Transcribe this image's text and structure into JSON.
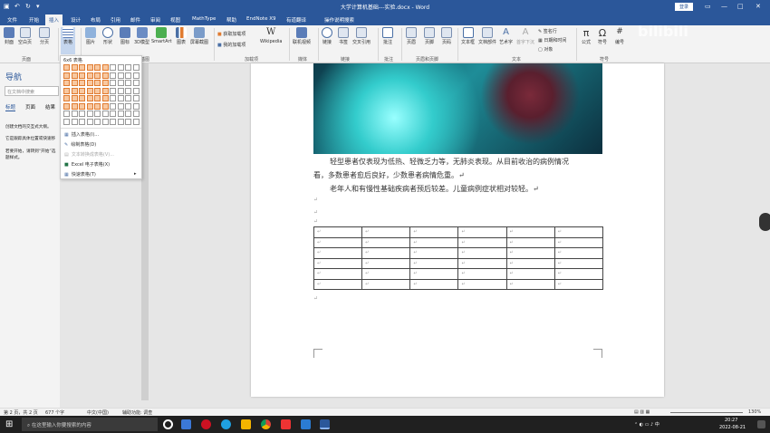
{
  "title": "大学计算机基础---实验.docx  -  Word",
  "user": "登录",
  "tabs": [
    "文件",
    "开始",
    "插入",
    "设计",
    "布局",
    "引用",
    "邮件",
    "审阅",
    "视图",
    "MathType",
    "帮助",
    "EndNote X9",
    "有道翻译",
    "操作说明搜索"
  ],
  "active_tab": "插入",
  "ribbon": {
    "buttons": [
      "封面",
      "空白页",
      "分页",
      "表格",
      "图片",
      "形状",
      "图标",
      "3D模型",
      "SmartArt",
      "图表",
      "屏幕截图",
      "获取加载项",
      "我的加载项",
      "Wikipedia",
      "联机视频",
      "链接",
      "书签",
      "交叉引用",
      "批注",
      "页眉",
      "页脚",
      "页码",
      "文本框",
      "文档部件",
      "艺术字",
      "首字下沉",
      "签名行",
      "日期和时间",
      "对象",
      "公式",
      "符号",
      "编号"
    ],
    "groups": [
      "页面",
      "插图",
      "加载项",
      "媒体",
      "链接",
      "批注",
      "页眉和页脚",
      "文本",
      "符号"
    ]
  },
  "table_popup": {
    "header": "6x6 表格",
    "menu": [
      "插入表格(I)...",
      "绘制表格(D)",
      "文本转换成表格(V)...",
      "Excel 电子表格(X)",
      "快速表格(T)"
    ]
  },
  "nav": {
    "title": "导航",
    "search_placeholder": "在文档中搜索",
    "tabs": [
      "标题",
      "页面",
      "结果"
    ],
    "desc": [
      "创建文档的交互式大纲。",
      "它是跟踪具体位置或快速移",
      "若要开始，请转到“开始”选",
      "题样式。"
    ]
  },
  "doc": {
    "para1a": "轻型患者仅表现为低热、轻微乏力等，无肺炎表现。从目前收治的病例情况",
    "para1b": "看，多数患者愈后良好，少数患者病情危重。↵",
    "para2": "老年人和有慢性基础疾病者预后较差。儿童病例症状相对较轻。↵",
    "mark": "↵",
    "table_rows": 6,
    "table_cols": 6
  },
  "status": {
    "page": "第 2 页，共 2 页",
    "words": "677 个字",
    "lang": "中文(中国)",
    "access": "辅助功能: 调查",
    "zoom": "130%"
  },
  "taskbar": {
    "search": "在这里输入你要搜索的内容",
    "time": "20:27",
    "date": "2022-08-21"
  },
  "watermark": "bilibili"
}
